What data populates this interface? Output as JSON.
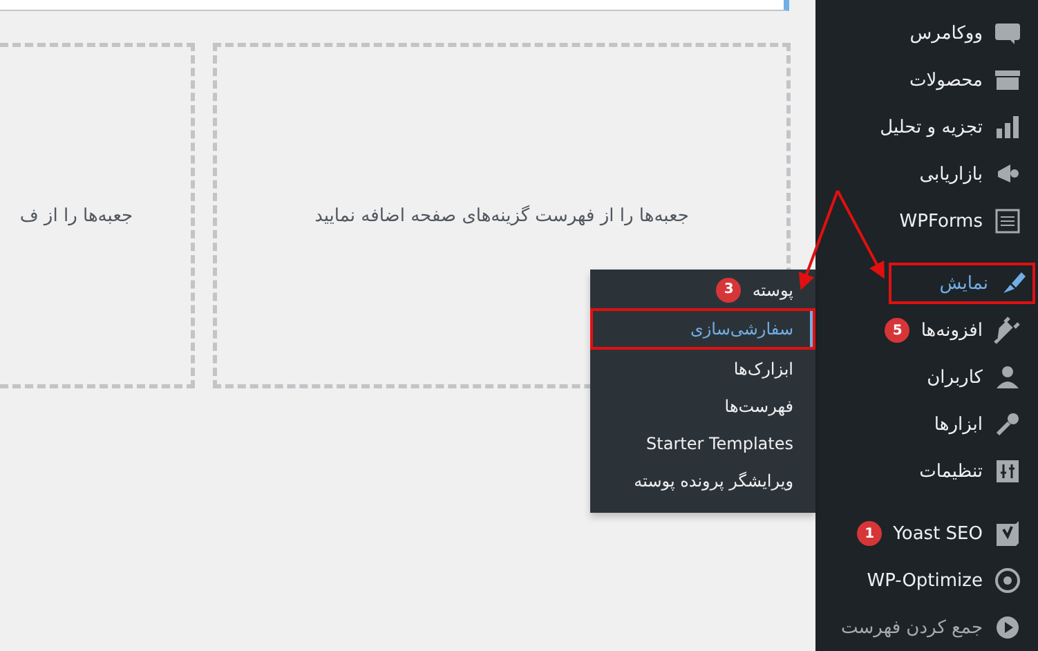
{
  "drop_zones": [
    {
      "text": "جعبه‌ها را از فهرست گزینه‌های صفحه اضافه نمایید"
    },
    {
      "text": "جعبه‌ها را از ف"
    }
  ],
  "sidebar": {
    "groups": [
      {
        "items": [
          {
            "label": "ووکامرس",
            "selected": false,
            "highlighted": false
          },
          {
            "label": "محصولات",
            "selected": false,
            "highlighted": false
          },
          {
            "label": "تجزیه و تحلیل",
            "selected": false,
            "highlighted": false
          },
          {
            "label": "بازاریابی",
            "selected": false,
            "highlighted": false
          },
          {
            "label": "WPForms",
            "selected": false,
            "highlighted": false
          }
        ]
      },
      {
        "items": [
          {
            "label": "نمایش",
            "selected": true,
            "highlighted": true
          },
          {
            "label": "افزونه‌ها",
            "selected": false,
            "highlighted": false,
            "badge": "5"
          },
          {
            "label": "کاربران",
            "selected": false,
            "highlighted": false
          },
          {
            "label": "ابزارها",
            "selected": false,
            "highlighted": false
          },
          {
            "label": "تنظیمات",
            "selected": false,
            "highlighted": false
          }
        ]
      },
      {
        "items": [
          {
            "label": "Yoast SEO",
            "selected": false,
            "highlighted": false,
            "badge": "1"
          },
          {
            "label": "WP-Optimize",
            "selected": false,
            "highlighted": false
          },
          {
            "label": "جمع کردن فهرست",
            "selected": false,
            "highlighted": false,
            "kind": "collapse"
          }
        ]
      }
    ]
  },
  "submenu": {
    "items": [
      {
        "label": "پوسته",
        "selected": false,
        "highlighted": false,
        "badge": "3"
      },
      {
        "label": "سفارشی‌سازی",
        "selected": true,
        "highlighted": true
      },
      {
        "label": "ابزارک‌ها",
        "selected": false,
        "highlighted": false
      },
      {
        "label": "فهرست‌ها",
        "selected": false,
        "highlighted": false
      },
      {
        "label": "Starter Templates",
        "selected": false,
        "highlighted": false
      },
      {
        "label": "ویرایشگر پرونده پوسته",
        "selected": false,
        "highlighted": false
      }
    ]
  }
}
